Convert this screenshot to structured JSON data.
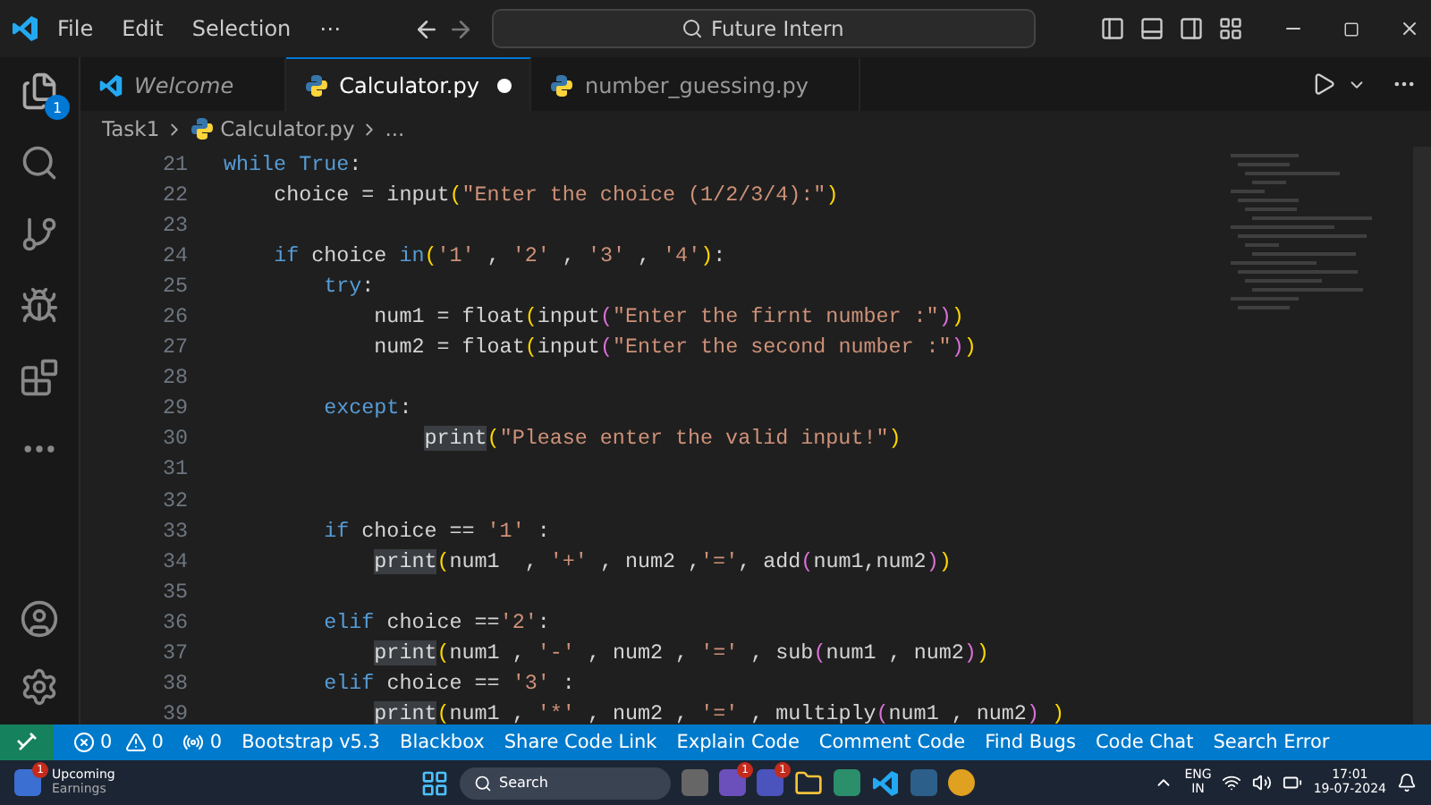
{
  "title_bar": {
    "menu": [
      "File",
      "Edit",
      "Selection",
      "⋯"
    ],
    "search": "Future Intern"
  },
  "activity_bar": {
    "explorer_badge": "1"
  },
  "tabs": [
    {
      "label": "Welcome",
      "kind": "welcome",
      "selected": false,
      "modified": false
    },
    {
      "label": "Calculator.py",
      "kind": "python",
      "selected": true,
      "modified": true
    },
    {
      "label": "number_guessing.py",
      "kind": "python",
      "selected": false,
      "modified": false
    }
  ],
  "breadcrumb": [
    "Task1",
    "Calculator.py",
    "..."
  ],
  "code": [
    {
      "n": "21",
      "tokens": [
        {
          "text": "while True",
          "kind": "kw"
        },
        {
          "text": ":",
          "kind": "p"
        }
      ]
    },
    {
      "n": "22",
      "tokens": [
        {
          "text": "    choice = input",
          "kind": "p"
        },
        {
          "text": "(",
          "kind": "b1"
        },
        {
          "text": "\"Enter the choice (1/2/3/4):\"",
          "kind": "s"
        },
        {
          "text": ")",
          "kind": "b1"
        }
      ]
    },
    {
      "n": "23"
    },
    {
      "n": "24",
      "tokens": [
        {
          "text": "    if",
          "kind": "kw"
        },
        {
          "text": " choice ",
          "kind": "p"
        },
        {
          "text": "in",
          "kind": "kw"
        },
        {
          "text": "(",
          "kind": "b1"
        },
        {
          "text": "'1'",
          "kind": "s"
        },
        {
          "text": " , ",
          "kind": "p"
        },
        {
          "text": "'2'",
          "kind": "s"
        },
        {
          "text": " , ",
          "kind": "p"
        },
        {
          "text": "'3'",
          "kind": "s"
        },
        {
          "text": " , ",
          "kind": "p"
        },
        {
          "text": "'4'",
          "kind": "s"
        },
        {
          "text": ")",
          "kind": "b1"
        },
        {
          "text": ":",
          "kind": "p"
        }
      ]
    },
    {
      "n": "25",
      "tokens": [
        {
          "text": "        try",
          "kind": "kw"
        },
        {
          "text": ":",
          "kind": "p"
        }
      ]
    },
    {
      "n": "26",
      "tokens": [
        {
          "text": "            num1 = float",
          "kind": "p"
        },
        {
          "text": "(",
          "kind": "b1"
        },
        {
          "text": "input",
          "kind": "p"
        },
        {
          "text": "(",
          "kind": "b2"
        },
        {
          "text": "\"Enter the firnt number :\"",
          "kind": "s"
        },
        {
          "text": ")",
          "kind": "b2"
        },
        {
          "text": ")",
          "kind": "b1"
        }
      ]
    },
    {
      "n": "27",
      "tokens": [
        {
          "text": "            num2 = float",
          "kind": "p"
        },
        {
          "text": "(",
          "kind": "b1"
        },
        {
          "text": "input",
          "kind": "p"
        },
        {
          "text": "(",
          "kind": "b2"
        },
        {
          "text": "\"Enter the second number :\"",
          "kind": "s"
        },
        {
          "text": ")",
          "kind": "b2"
        },
        {
          "text": ")",
          "kind": "b1"
        }
      ]
    },
    {
      "n": "28"
    },
    {
      "n": "29",
      "tokens": [
        {
          "text": "        except",
          "kind": "kw"
        },
        {
          "text": ":",
          "kind": "p"
        }
      ]
    },
    {
      "n": "30",
      "tokens": [
        {
          "text": "                print",
          "kind": "hl"
        },
        {
          "text": "(",
          "kind": "b1"
        },
        {
          "text": "\"Please enter the valid input!\"",
          "kind": "s"
        },
        {
          "text": ")",
          "kind": "b1"
        }
      ]
    },
    {
      "n": "31"
    },
    {
      "n": "32"
    },
    {
      "n": "33",
      "tokens": [
        {
          "text": "        if",
          "kind": "kw"
        },
        {
          "text": " choice == ",
          "kind": "p"
        },
        {
          "text": "'1'",
          "kind": "s"
        },
        {
          "text": " :",
          "kind": "p"
        }
      ]
    },
    {
      "n": "34",
      "tokens": [
        {
          "text": "            print",
          "kind": "hl"
        },
        {
          "text": "(",
          "kind": "b1"
        },
        {
          "text": "num1  , ",
          "kind": "p"
        },
        {
          "text": "'+'",
          "kind": "s"
        },
        {
          "text": " , num2 ,",
          "kind": "p"
        },
        {
          "text": "'='",
          "kind": "s"
        },
        {
          "text": ", add",
          "kind": "p"
        },
        {
          "text": "(",
          "kind": "b2"
        },
        {
          "text": "num1,num2",
          "kind": "p"
        },
        {
          "text": ")",
          "kind": "b2"
        },
        {
          "text": ")",
          "kind": "b1"
        }
      ]
    },
    {
      "n": "35"
    },
    {
      "n": "36",
      "tokens": [
        {
          "text": "        elif",
          "kind": "kw"
        },
        {
          "text": " choice ==",
          "kind": "p"
        },
        {
          "text": "'2'",
          "kind": "s"
        },
        {
          "text": ":",
          "kind": "p"
        }
      ]
    },
    {
      "n": "37",
      "tokens": [
        {
          "text": "            print",
          "kind": "hl"
        },
        {
          "text": "(",
          "kind": "b1"
        },
        {
          "text": "num1 , ",
          "kind": "p"
        },
        {
          "text": "'-'",
          "kind": "s"
        },
        {
          "text": " , num2 , ",
          "kind": "p"
        },
        {
          "text": "'='",
          "kind": "s"
        },
        {
          "text": " , sub",
          "kind": "p"
        },
        {
          "text": "(",
          "kind": "b2"
        },
        {
          "text": "num1 , num2",
          "kind": "p"
        },
        {
          "text": ")",
          "kind": "b2"
        },
        {
          "text": ")",
          "kind": "b1"
        }
      ]
    },
    {
      "n": "38",
      "tokens": [
        {
          "text": "        elif",
          "kind": "kw"
        },
        {
          "text": " choice == ",
          "kind": "p"
        },
        {
          "text": "'3'",
          "kind": "s"
        },
        {
          "text": " :",
          "kind": "p"
        }
      ]
    },
    {
      "n": "39",
      "tokens": [
        {
          "text": "            print",
          "kind": "hl"
        },
        {
          "text": "(",
          "kind": "b1"
        },
        {
          "text": "num1 , ",
          "kind": "p"
        },
        {
          "text": "'*'",
          "kind": "s"
        },
        {
          "text": " , num2 , ",
          "kind": "p"
        },
        {
          "text": "'='",
          "kind": "s"
        },
        {
          "text": " , multiply",
          "kind": "p"
        },
        {
          "text": "(",
          "kind": "b2"
        },
        {
          "text": "num1 , num2",
          "kind": "p"
        },
        {
          "text": ")",
          "kind": "b2"
        },
        {
          "text": " )",
          "kind": "b1"
        }
      ]
    }
  ],
  "status_bar": {
    "errors": "0",
    "warnings": "0",
    "ports": "0",
    "items": [
      "Bootstrap v5.3",
      "Blackbox",
      "Share Code Link",
      "Explain Code",
      "Comment Code",
      "Find Bugs",
      "Code Chat",
      "Search Error"
    ]
  },
  "taskbar": {
    "widget": [
      "Upcoming",
      "Earnings"
    ],
    "widget_badge": "1",
    "search": "Search",
    "app_badges": [
      "1",
      "1"
    ],
    "language": [
      "ENG",
      "IN"
    ],
    "time": "17:01",
    "date": "19-07-2024"
  }
}
